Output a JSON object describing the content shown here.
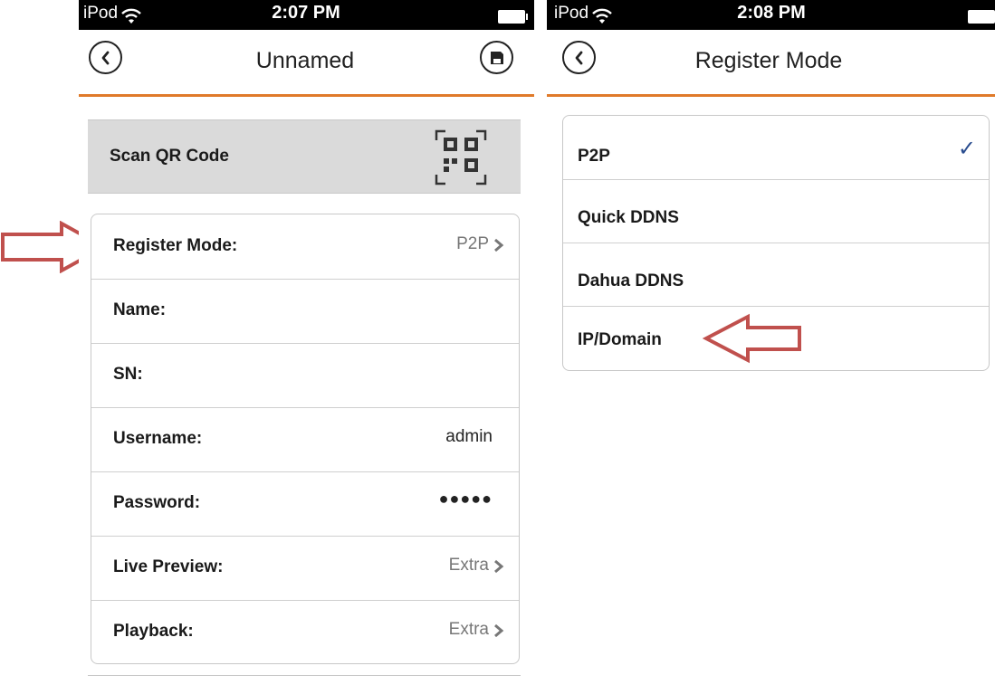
{
  "left_screen": {
    "status": {
      "carrier": "iPod",
      "time": "2:07 PM"
    },
    "title": "Unnamed",
    "qr_label": "Scan QR Code",
    "rows": [
      {
        "label": "Register Mode:",
        "value": "P2P"
      },
      {
        "label": "Name:",
        "value": ""
      },
      {
        "label": "SN:",
        "value": ""
      },
      {
        "label": "Username:",
        "value": "admin"
      },
      {
        "label": "Password:",
        "value": "●●●●●"
      },
      {
        "label": "Live Preview:",
        "value": "Extra"
      },
      {
        "label": "Playback:",
        "value": "Extra"
      }
    ]
  },
  "right_screen": {
    "status": {
      "carrier": "iPod",
      "time": "2:08 PM"
    },
    "title": "Register Mode",
    "options": [
      {
        "label": "P2P",
        "selected": true
      },
      {
        "label": "Quick DDNS",
        "selected": false
      },
      {
        "label": "Dahua DDNS",
        "selected": false
      },
      {
        "label": "IP/Domain",
        "selected": false
      }
    ],
    "checkmark": "✓"
  },
  "colors": {
    "nav_underline": "#e07a2a",
    "annotation_arrow": "#c0504d",
    "checkmark": "#2a4d8f",
    "qr_row_bg": "#dadada"
  },
  "icons": [
    "back-icon",
    "save-icon",
    "qr-code-icon",
    "chevron-right-icon",
    "checkmark-icon",
    "wifi-icon",
    "battery-icon"
  ]
}
